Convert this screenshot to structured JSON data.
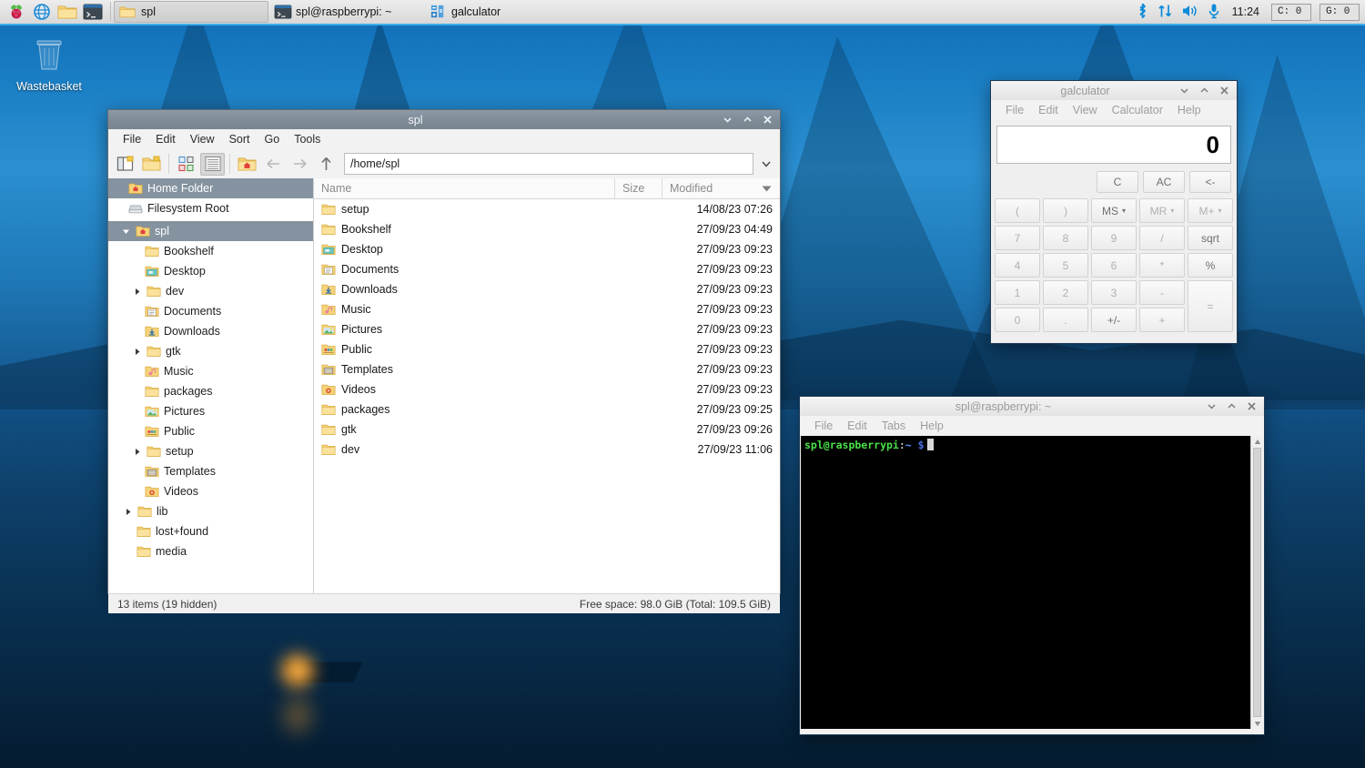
{
  "desktop": {
    "icons": [
      {
        "label": "Wastebasket",
        "icon": "wastebasket-icon"
      }
    ]
  },
  "taskbar": {
    "launchers": [
      {
        "name": "raspberry-menu-icon",
        "title": "Menu"
      },
      {
        "name": "web-browser-icon",
        "title": "Web Browser"
      },
      {
        "name": "file-manager-icon",
        "title": "File Manager"
      },
      {
        "name": "terminal-icon",
        "title": "Terminal"
      }
    ],
    "tasks": [
      {
        "label": "spl",
        "icon": "folder-icon",
        "active": true
      },
      {
        "label": "spl@raspberrypi: ~",
        "icon": "terminal-icon",
        "active": false
      },
      {
        "label": "galculator",
        "icon": "calculator-icon",
        "active": false
      }
    ],
    "tray": {
      "bluetooth": "bluetooth-icon",
      "network": "network-updown-icon",
      "volume": "volume-icon",
      "microphone": "microphone-icon"
    },
    "clock": "11:24",
    "cpu_meter": "C:   0",
    "gpu_meter": "G:   0"
  },
  "filemanager": {
    "title": "spl",
    "menus": [
      "File",
      "Edit",
      "View",
      "Sort",
      "Go",
      "Tools"
    ],
    "toolbar": [
      {
        "name": "new-tab-button",
        "icon": "new-tab-icon"
      },
      {
        "name": "new-folder-button",
        "icon": "new-folder-icon"
      },
      {
        "name": "icon-view-button",
        "icon": "icon-view-icon"
      },
      {
        "name": "list-view-button",
        "icon": "list-view-icon"
      },
      {
        "name": "home-button",
        "icon": "home-folder-icon"
      },
      {
        "name": "back-button",
        "icon": "arrow-left-icon"
      },
      {
        "name": "forward-button",
        "icon": "arrow-right-icon"
      },
      {
        "name": "up-button",
        "icon": "arrow-up-icon"
      }
    ],
    "path": "/home/spl",
    "sidebar": [
      {
        "label": "Home Folder",
        "icon": "home-icon",
        "indent": 0,
        "selected": true,
        "twisty": ""
      },
      {
        "label": "Filesystem Root",
        "icon": "drive-icon",
        "indent": 0,
        "selected": false,
        "twisty": ""
      },
      {
        "label": "spl",
        "icon": "home-icon",
        "indent": 1,
        "selected": true,
        "twisty": "down"
      },
      {
        "label": "Bookshelf",
        "icon": "folder-icon",
        "indent": 2,
        "selected": false,
        "twisty": ""
      },
      {
        "label": "Desktop",
        "icon": "folder-desktop-icon",
        "indent": 2,
        "selected": false,
        "twisty": ""
      },
      {
        "label": "dev",
        "icon": "folder-icon",
        "indent": 2,
        "selected": false,
        "twisty": "right"
      },
      {
        "label": "Documents",
        "icon": "folder-documents-icon",
        "indent": 2,
        "selected": false,
        "twisty": ""
      },
      {
        "label": "Downloads",
        "icon": "folder-downloads-icon",
        "indent": 2,
        "selected": false,
        "twisty": ""
      },
      {
        "label": "gtk",
        "icon": "folder-icon",
        "indent": 2,
        "selected": false,
        "twisty": "right"
      },
      {
        "label": "Music",
        "icon": "folder-music-icon",
        "indent": 2,
        "selected": false,
        "twisty": ""
      },
      {
        "label": "packages",
        "icon": "folder-icon",
        "indent": 2,
        "selected": false,
        "twisty": ""
      },
      {
        "label": "Pictures",
        "icon": "folder-pictures-icon",
        "indent": 2,
        "selected": false,
        "twisty": ""
      },
      {
        "label": "Public",
        "icon": "folder-public-icon",
        "indent": 2,
        "selected": false,
        "twisty": ""
      },
      {
        "label": "setup",
        "icon": "folder-icon",
        "indent": 2,
        "selected": false,
        "twisty": "right"
      },
      {
        "label": "Templates",
        "icon": "folder-templates-icon",
        "indent": 2,
        "selected": false,
        "twisty": ""
      },
      {
        "label": "Videos",
        "icon": "folder-videos-icon",
        "indent": 2,
        "selected": false,
        "twisty": ""
      },
      {
        "label": "lib",
        "icon": "folder-icon",
        "indent": 1,
        "selected": false,
        "twisty": "right"
      },
      {
        "label": "lost+found",
        "icon": "folder-icon",
        "indent": 1,
        "selected": false,
        "twisty": ""
      },
      {
        "label": "media",
        "icon": "folder-icon",
        "indent": 1,
        "selected": false,
        "twisty": ""
      }
    ],
    "columns": {
      "name": "Name",
      "size": "Size",
      "modified": "Modified"
    },
    "sort_direction": "descending",
    "files": [
      {
        "name": "setup",
        "icon": "folder-icon",
        "size": "",
        "modified": "14/08/23 07:26"
      },
      {
        "name": "Bookshelf",
        "icon": "folder-icon",
        "size": "",
        "modified": "27/09/23 04:49"
      },
      {
        "name": "Desktop",
        "icon": "folder-desktop-icon",
        "size": "",
        "modified": "27/09/23 09:23"
      },
      {
        "name": "Documents",
        "icon": "folder-documents-icon",
        "size": "",
        "modified": "27/09/23 09:23"
      },
      {
        "name": "Downloads",
        "icon": "folder-downloads-icon",
        "size": "",
        "modified": "27/09/23 09:23"
      },
      {
        "name": "Music",
        "icon": "folder-music-icon",
        "size": "",
        "modified": "27/09/23 09:23"
      },
      {
        "name": "Pictures",
        "icon": "folder-pictures-icon",
        "size": "",
        "modified": "27/09/23 09:23"
      },
      {
        "name": "Public",
        "icon": "folder-public-icon",
        "size": "",
        "modified": "27/09/23 09:23"
      },
      {
        "name": "Templates",
        "icon": "folder-templates-icon",
        "size": "",
        "modified": "27/09/23 09:23"
      },
      {
        "name": "Videos",
        "icon": "folder-videos-icon",
        "size": "",
        "modified": "27/09/23 09:23"
      },
      {
        "name": "packages",
        "icon": "folder-icon",
        "size": "",
        "modified": "27/09/23 09:25"
      },
      {
        "name": "gtk",
        "icon": "folder-icon",
        "size": "",
        "modified": "27/09/23 09:26"
      },
      {
        "name": "dev",
        "icon": "folder-icon",
        "size": "",
        "modified": "27/09/23 11:06"
      }
    ],
    "status_left": "13 items (19 hidden)",
    "status_right": "Free space: 98.0 GiB (Total: 109.5 GiB)"
  },
  "galculator": {
    "title": "galculator",
    "menus": [
      "File",
      "Edit",
      "View",
      "Calculator",
      "Help"
    ],
    "display": "0",
    "top_buttons": [
      "C",
      "AC",
      "<-"
    ],
    "keys": [
      {
        "label": "(",
        "dropdown": false
      },
      {
        "label": ")",
        "dropdown": false
      },
      {
        "label": "MS",
        "dropdown": true
      },
      {
        "label": "MR",
        "dropdown": true
      },
      {
        "label": "M+",
        "dropdown": true
      },
      {
        "label": "7",
        "dropdown": false
      },
      {
        "label": "8",
        "dropdown": false
      },
      {
        "label": "9",
        "dropdown": false
      },
      {
        "label": "/",
        "dropdown": false
      },
      {
        "label": "sqrt",
        "dropdown": false
      },
      {
        "label": "4",
        "dropdown": false
      },
      {
        "label": "5",
        "dropdown": false
      },
      {
        "label": "6",
        "dropdown": false
      },
      {
        "label": "*",
        "dropdown": false
      },
      {
        "label": "%",
        "dropdown": false
      },
      {
        "label": "1",
        "dropdown": false
      },
      {
        "label": "2",
        "dropdown": false
      },
      {
        "label": "3",
        "dropdown": false
      },
      {
        "label": "-",
        "dropdown": false
      },
      {
        "label": "=",
        "dropdown": false,
        "span": 2
      },
      {
        "label": "0",
        "dropdown": false
      },
      {
        "label": ".",
        "dropdown": false
      },
      {
        "label": "+/-",
        "dropdown": false
      },
      {
        "label": "+",
        "dropdown": false
      }
    ]
  },
  "terminal": {
    "title": "spl@raspberrypi: ~",
    "menus": [
      "File",
      "Edit",
      "Tabs",
      "Help"
    ],
    "prompt_user": "spl@raspberrypi",
    "prompt_colon": ":",
    "prompt_path": "~",
    "prompt_symbol": "$"
  },
  "colors": {
    "accent": "#3daee9",
    "titlebar_active": "#808d9a",
    "selection": "#8593a0",
    "terminal_bg": "#000000",
    "prompt_green": "#4ae24a",
    "prompt_blue": "#5f8ff5"
  }
}
